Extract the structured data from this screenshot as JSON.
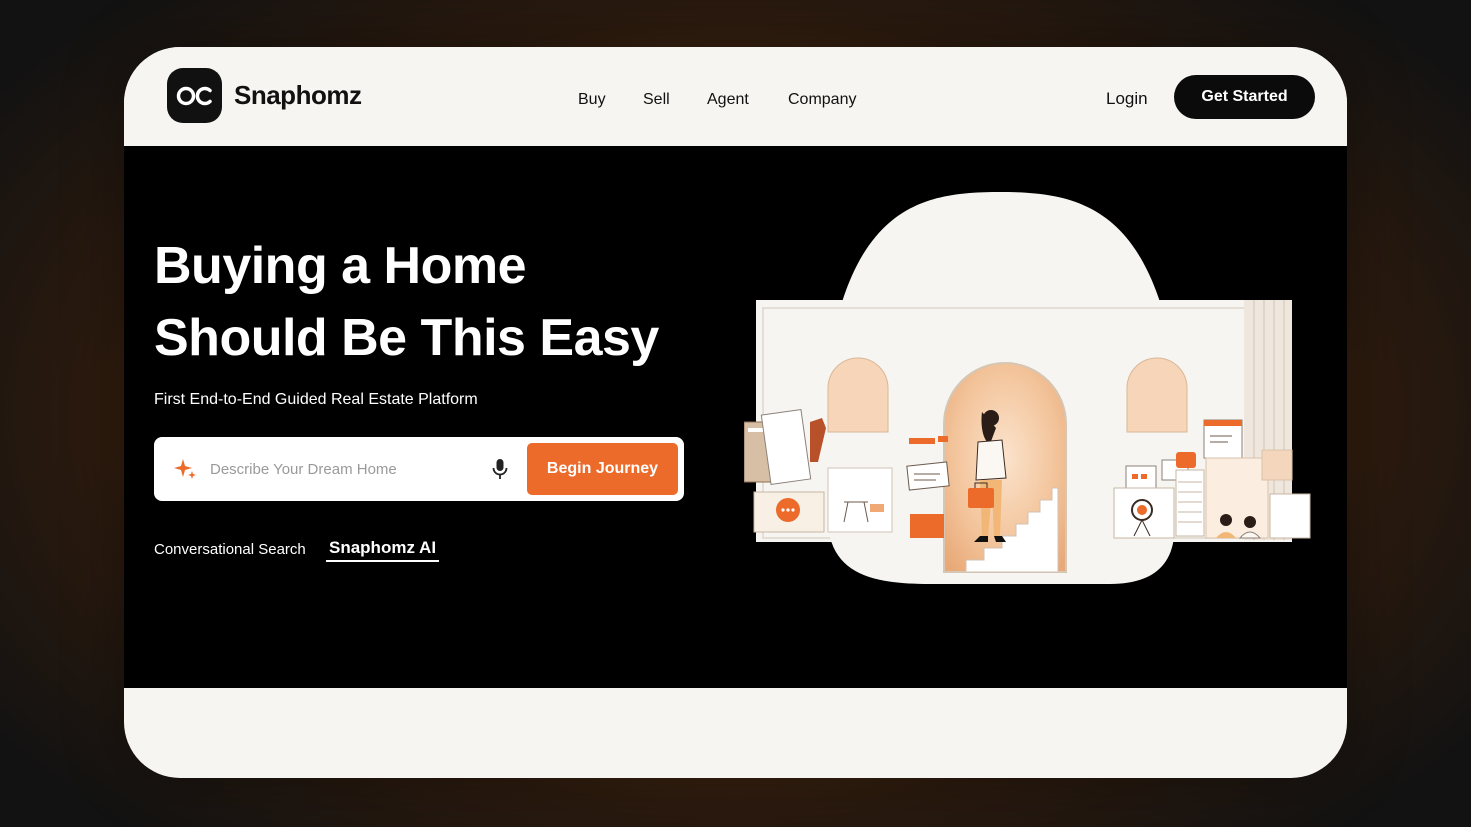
{
  "brand": {
    "logo_text": "OC",
    "name": "Snaphomz"
  },
  "nav": {
    "items": [
      {
        "label": "Buy"
      },
      {
        "label": "Sell"
      },
      {
        "label": "Agent"
      },
      {
        "label": "Company"
      }
    ],
    "login_label": "Login",
    "cta_label": "Get Started"
  },
  "hero": {
    "title_line_1": "Buying a Home",
    "title_line_2": "Should Be This Easy",
    "subtitle": "First End-to-End Guided Real Estate Platform",
    "search": {
      "placeholder": "Describe Your Dream Home",
      "value": "",
      "button_label": "Begin Journey"
    },
    "conversational_label": "Conversational Search",
    "ai_link_label": "Snaphomz AI"
  },
  "icons": {
    "sparkle": "sparkle-icon",
    "microphone": "microphone-icon",
    "illustration": "home-buying-illustration"
  },
  "colors": {
    "accent": "#ec6a2a",
    "hero_background": "#000000",
    "surface": "#f7f5f1",
    "ink": "#111111",
    "peach": "#f6d5b8"
  }
}
